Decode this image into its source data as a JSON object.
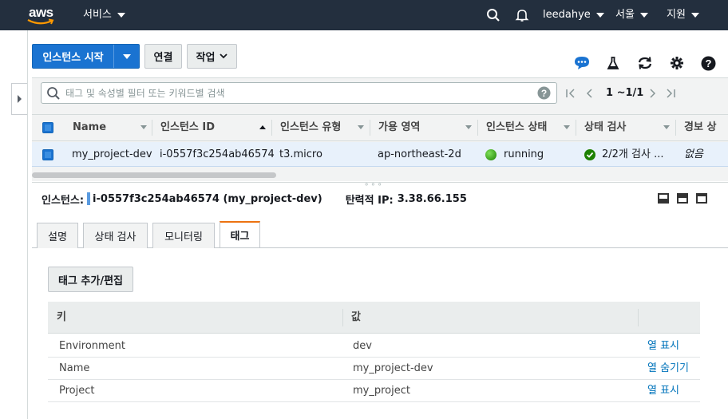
{
  "nav": {
    "logo": "aws",
    "services": "서비스",
    "user": "leedahye",
    "region": "서울",
    "support": "지원"
  },
  "actions": {
    "launch": "인스턴스 시작",
    "connect": "연결",
    "actions": "작업"
  },
  "search": {
    "placeholder": "태그 및 속성별 필터 또는 키워드별 검색"
  },
  "pager": {
    "label": "1 ~1/1"
  },
  "table": {
    "columns": [
      "Name",
      "인스턴스 ID",
      "인스턴스 유형",
      "가용 영역",
      "인스턴스 상태",
      "상태 검사",
      "경보 상"
    ],
    "row": {
      "name": "my_project-dev",
      "instance_id": "i-0557f3c254ab46574",
      "type": "t3.micro",
      "az": "ap-northeast-2d",
      "state": "running",
      "status_check": "2/2개 검사 ...",
      "alarm": "없음"
    }
  },
  "details": {
    "instance_label": "인스턴스:",
    "instance_value": "i-0557f3c254ab46574 (my_project-dev)",
    "eip_label": "탄력적 IP:",
    "eip_value": "3.38.66.155"
  },
  "tabs": [
    "설명",
    "상태 검사",
    "모니터링",
    "태그"
  ],
  "tags": {
    "edit_button": "태그 추가/편집",
    "headers": [
      "키",
      "값"
    ],
    "rows": [
      {
        "key": "Environment",
        "value": "dev",
        "action": "열 표시"
      },
      {
        "key": "Name",
        "value": "my_project-dev",
        "action": "열 숨기기"
      },
      {
        "key": "Project",
        "value": "my_project",
        "action": "열 표시"
      }
    ]
  },
  "colors": {
    "nav_bg": "#232f3e",
    "primary": "#1a73d1",
    "running": "#1d8102",
    "active_tab": "#ec7211",
    "link": "#0073bb"
  }
}
